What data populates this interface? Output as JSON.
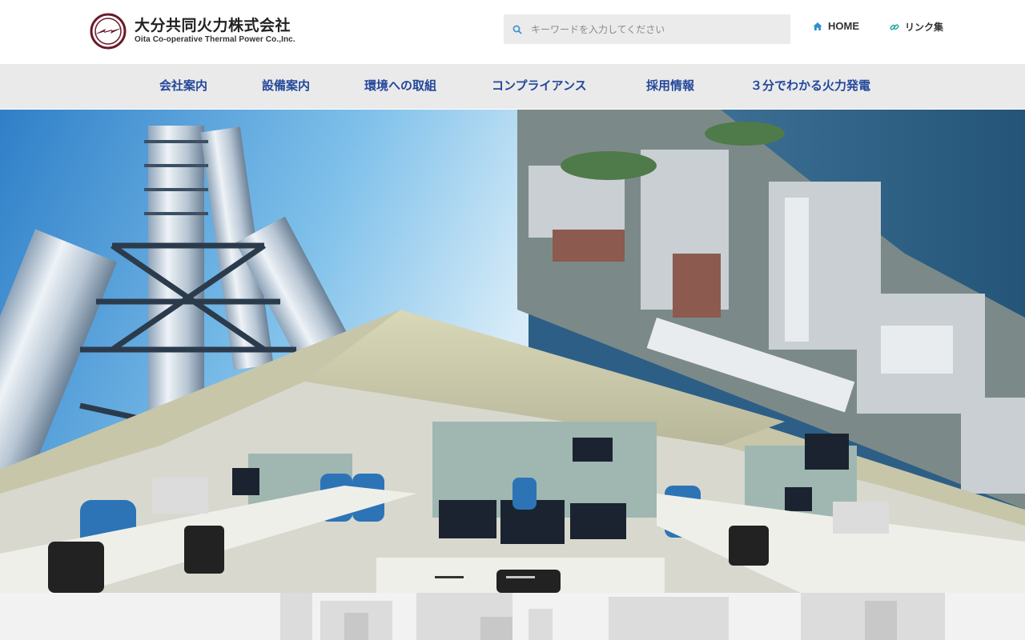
{
  "header": {
    "logo_jp": "大分共同火力株式会社",
    "logo_en": "Oita Co-operative Thermal Power Co.,Inc.",
    "search_placeholder": "キーワードを入力してください",
    "home_label": "HOME",
    "links_label": "リンク集"
  },
  "nav": {
    "items": [
      {
        "label": "会社案内"
      },
      {
        "label": "設備案内"
      },
      {
        "label": "環境への取組"
      },
      {
        "label": "コンプライアンス"
      },
      {
        "label": "採用情報"
      },
      {
        "label": "３分でわかる火力発電"
      }
    ]
  },
  "slider": {
    "active_index": 0,
    "count": 2
  },
  "colors": {
    "brand": "#6b1a2a",
    "nav_text": "#23479a",
    "nav_bg": "#eaeaea",
    "search_bg": "#ebebeb",
    "icon_blue": "#2e8fd1",
    "icon_teal": "#19a5a0"
  }
}
